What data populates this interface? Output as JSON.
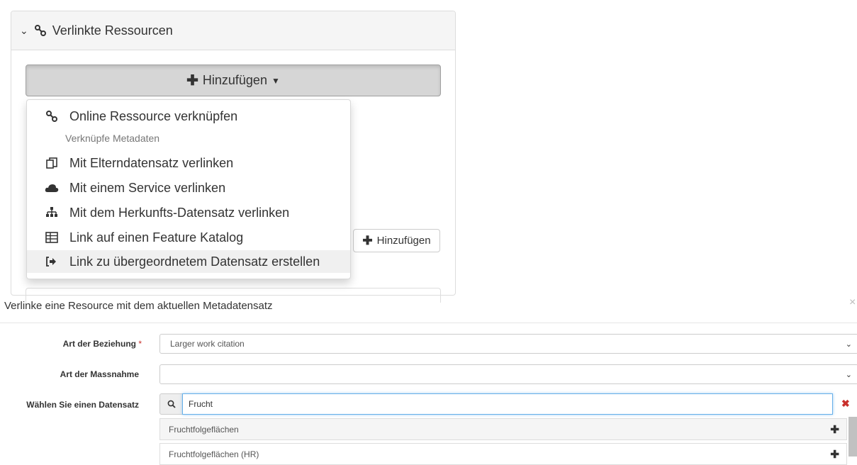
{
  "panel": {
    "title": "Verlinkte Ressourcen",
    "add_button_label": "Hinzufügen",
    "small_add_label": "Hinzufügen"
  },
  "menu": {
    "items": [
      {
        "label": "Online Ressource verknüpfen",
        "icon": "link-icon"
      },
      {
        "label": "Mit Elterndatensatz verlinken",
        "icon": "copy-icon"
      },
      {
        "label": "Mit einem Service verlinken",
        "icon": "cloud-icon"
      },
      {
        "label": "Mit dem Herkunfts-Datensatz verlinken",
        "icon": "sitemap-icon"
      },
      {
        "label": "Link auf einen Feature Katalog",
        "icon": "table-icon"
      },
      {
        "label": "Link zu übergeordnetem Datensatz erstellen",
        "icon": "sign-in-icon"
      }
    ],
    "header": "Verknüpfe Metadaten"
  },
  "modal": {
    "title": "Verlinke eine Resource mit dem aktuellen Metadatensatz",
    "close": "×"
  },
  "form": {
    "relation_label": "Art der Beziehung",
    "required_mark": "*",
    "relation_value": "Larger work citation",
    "measure_label": "Art der Massnahme",
    "measure_value": "",
    "dataset_label": "Wählen Sie einen Datensatz",
    "search_value": "Frucht",
    "clear": "✖",
    "results": [
      "Fruchtfolgeflächen",
      "Fruchtfolgeflächen (HR)"
    ]
  }
}
